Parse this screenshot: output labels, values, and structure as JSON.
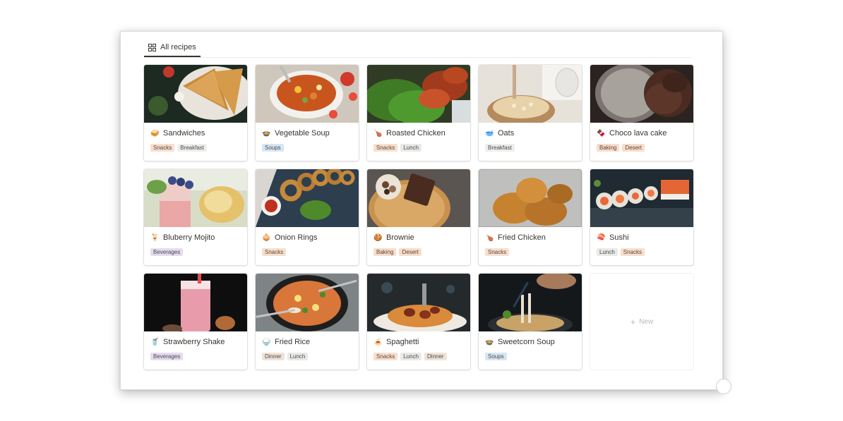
{
  "view": {
    "tab_label": "All recipes",
    "tab_icon": "grid-icon"
  },
  "tag_colors": {
    "Snacks": "#fadecb",
    "Breakfast": "#eeeeec",
    "Soups": "#d6e6f3",
    "Lunch": "#e9e9e7",
    "Baking": "#fbdcc8",
    "Desert": "#fbdcc8",
    "Beverages": "#e5dcef",
    "Dinner": "#efe3d8"
  },
  "cards": [
    {
      "title": "Sandwiches",
      "emoji": "🥪",
      "tags": [
        "Snacks",
        "Breakfast"
      ],
      "image": "sandwiches-photo"
    },
    {
      "title": "Vegetable Soup",
      "emoji": "🍲",
      "tags": [
        "Soups"
      ],
      "image": "vegetable-soup-photo"
    },
    {
      "title": "Roasted Chicken",
      "emoji": "🍗",
      "tags": [
        "Snacks",
        "Lunch"
      ],
      "image": "roasted-chicken-photo"
    },
    {
      "title": "Oats",
      "emoji": "🥣",
      "tags": [
        "Breakfast"
      ],
      "image": "oats-photo"
    },
    {
      "title": "Choco lava cake",
      "emoji": "🍫",
      "tags": [
        "Baking",
        "Desert"
      ],
      "image": "choco-lava-cake-photo"
    },
    {
      "title": "Bluberry Mojito",
      "emoji": "🍹",
      "tags": [
        "Beverages"
      ],
      "image": "blueberry-mojito-photo"
    },
    {
      "title": "Onion Rings",
      "emoji": "🧅",
      "tags": [
        "Snacks"
      ],
      "image": "onion-rings-photo"
    },
    {
      "title": "Brownie",
      "emoji": "🍪",
      "tags": [
        "Baking",
        "Desert"
      ],
      "image": "brownie-photo"
    },
    {
      "title": "Fried Chicken",
      "emoji": "🍗",
      "tags": [
        "Snacks"
      ],
      "image": "fried-chicken-photo"
    },
    {
      "title": "Sushi",
      "emoji": "🍣",
      "tags": [
        "Lunch",
        "Snacks"
      ],
      "image": "sushi-photo"
    },
    {
      "title": "Strawberry Shake",
      "emoji": "🥤",
      "tags": [
        "Beverages"
      ],
      "image": "strawberry-shake-photo"
    },
    {
      "title": "Fried Rice",
      "emoji": "🍚",
      "tags": [
        "Dinner",
        "Lunch"
      ],
      "image": "fried-rice-photo"
    },
    {
      "title": "Spaghetti",
      "emoji": "🍝",
      "tags": [
        "Snacks",
        "Lunch",
        "Dinner"
      ],
      "image": "spaghetti-photo"
    },
    {
      "title": "Sweetcorn Soup",
      "emoji": "🍲",
      "tags": [
        "Soups"
      ],
      "image": "sweetcorn-soup-photo"
    }
  ],
  "new_card": {
    "label": "New",
    "icon": "plus-icon"
  }
}
